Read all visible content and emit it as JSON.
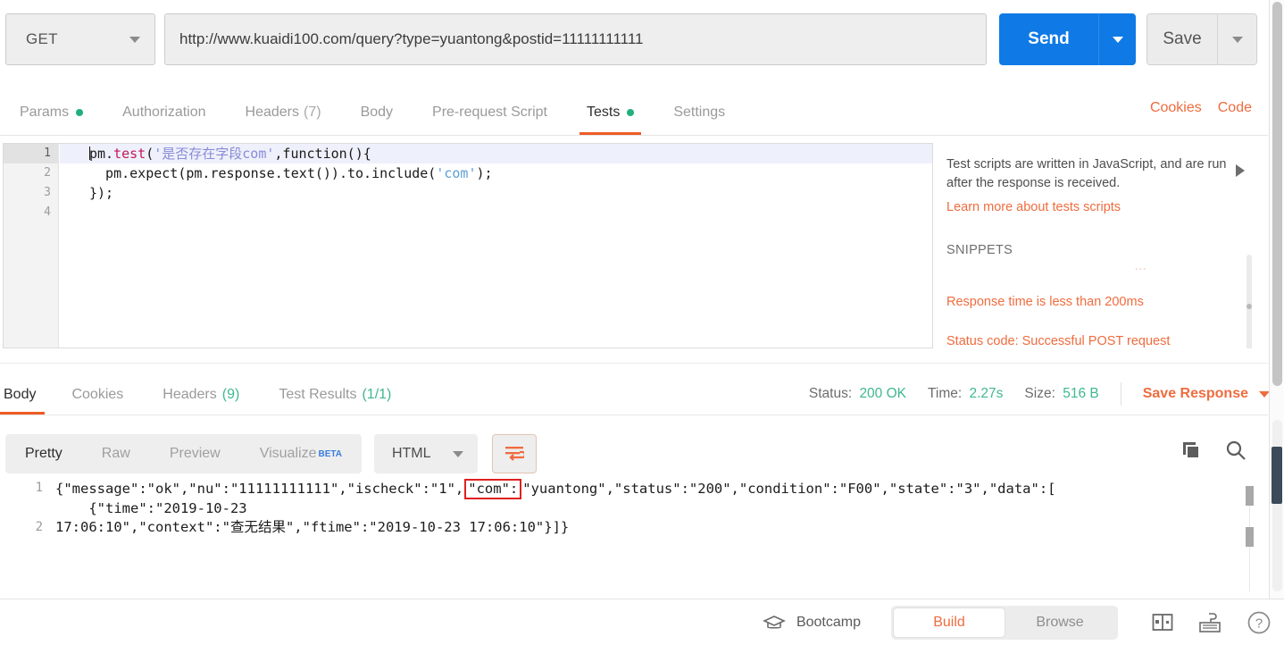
{
  "request": {
    "method": "GET",
    "url": "http://www.kuaidi100.com/query?type=yuantong&postid=11111111111",
    "send_label": "Send",
    "save_label": "Save",
    "tabs": [
      {
        "label": "Params",
        "badge": "dot",
        "active": false
      },
      {
        "label": "Authorization",
        "badge": "",
        "active": false
      },
      {
        "label": "Headers",
        "count": "(7)",
        "badge": "count",
        "active": false
      },
      {
        "label": "Body",
        "badge": "",
        "active": false
      },
      {
        "label": "Pre-request Script",
        "badge": "",
        "active": false
      },
      {
        "label": "Tests",
        "badge": "dot",
        "active": true
      },
      {
        "label": "Settings",
        "badge": "",
        "active": false
      }
    ],
    "links": {
      "cookies": "Cookies",
      "code": "Code"
    }
  },
  "editor": {
    "line_numbers": [
      "1",
      "2",
      "3",
      "4"
    ],
    "code": {
      "l1_a": "pm.",
      "l1_b": "test",
      "l1_c": "(",
      "l1_str": "'是否存在字段com'",
      "l1_d": ",function(){",
      "l2": "  pm.expect(pm.response.text()).to.include(",
      "l2_str": "'com'",
      "l2_end": ");",
      "l3": "});"
    }
  },
  "help": {
    "description": "Test scripts are written in JavaScript, and are run after the response is received.",
    "learn_more": "Learn more about tests scripts",
    "snippets_title": "SNIPPETS",
    "snippets": [
      "Response time is less than 200ms",
      "Status code: Successful POST request"
    ]
  },
  "response": {
    "tabs": [
      {
        "label": "Body",
        "count": "",
        "active": true
      },
      {
        "label": "Cookies",
        "count": "",
        "active": false
      },
      {
        "label": "Headers",
        "count": "(9)",
        "active": false
      },
      {
        "label": "Test Results",
        "count": "(1/1)",
        "active": false
      }
    ],
    "meta": {
      "status_label": "Status:",
      "status_value": "200 OK",
      "time_label": "Time:",
      "time_value": "2.27s",
      "size_label": "Size:",
      "size_value": "516 B",
      "save_response": "Save Response"
    },
    "toolbar": {
      "formats": [
        {
          "label": "Pretty",
          "active": true
        },
        {
          "label": "Raw",
          "active": false
        },
        {
          "label": "Preview",
          "active": false
        },
        {
          "label": "Visualize",
          "sup": "BETA",
          "active": false
        }
      ],
      "language": "HTML"
    },
    "body": {
      "line_numbers": [
        "1",
        "2"
      ],
      "line1_pre": "{\"message\":\"ok\",\"nu\":\"11111111111\",\"ischeck\":\"1\",",
      "line1_highlight": "\"com\":",
      "line1_post": "\"yuantong\",\"status\":\"200\",\"condition\":\"F00\",\"state\":\"3\",\"data\":[",
      "line1_wrap": "    {\"time\":\"2019-10-23",
      "line2": "17:06:10\",\"context\":\"查无结果\",\"ftime\":\"2019-10-23 17:06:10\"}]}"
    }
  },
  "statusbar": {
    "bootcamp": "Bootcamp",
    "build": "Build",
    "browse": "Browse"
  },
  "colors": {
    "accent_orange": "#ef5b25",
    "link_orange": "#ef6c3e",
    "send_blue": "#0f7ae5",
    "status_green": "#3fb88f",
    "highlight_red": "#e02020"
  }
}
